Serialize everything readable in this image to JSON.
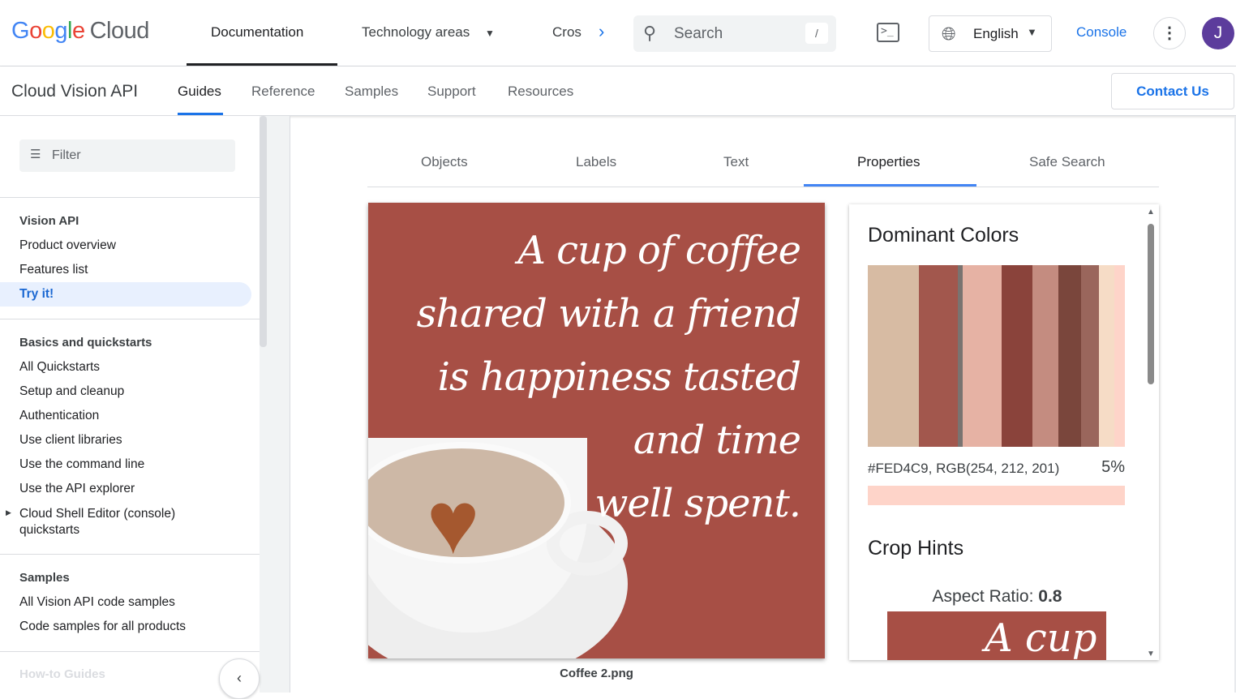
{
  "header": {
    "logo": "Google Cloud",
    "logo_parts": [
      "G",
      "o",
      "o",
      "g",
      "l",
      "e"
    ],
    "logo_cloud": "Cloud",
    "nav": [
      "Documentation",
      "Technology areas",
      "Cros"
    ],
    "search_placeholder": "Search",
    "search_shortcut": "/",
    "language": "English",
    "console": "Console",
    "avatar": "J"
  },
  "subnav": {
    "product": "Cloud Vision API",
    "items": [
      "Guides",
      "Reference",
      "Samples",
      "Support",
      "Resources"
    ],
    "contact": "Contact Us"
  },
  "sidebar": {
    "filter_placeholder": "Filter",
    "sections": [
      {
        "title": "Vision API",
        "items": [
          "Product overview",
          "Features list",
          "Try it!"
        ]
      },
      {
        "title": "Basics and quickstarts",
        "items": [
          "All Quickstarts",
          "Setup and cleanup",
          "Authentication",
          "Use client libraries",
          "Use the command line",
          "Use the API explorer",
          "Cloud Shell Editor (console) quickstarts"
        ]
      },
      {
        "title": "Samples",
        "items": [
          "All Vision API code samples",
          "Code samples for all products"
        ]
      },
      {
        "title": "How-to Guides"
      }
    ]
  },
  "tabs": [
    "Objects",
    "Labels",
    "Text",
    "Properties",
    "Safe Search"
  ],
  "image": {
    "quote_lines": [
      "A cup of coffee",
      "shared with a friend",
      "is happiness tasted",
      "and time",
      "well spent."
    ],
    "caption": "Coffee 2.png"
  },
  "properties": {
    "dominant_title": "Dominant Colors",
    "colors": [
      {
        "hex": "#D7BBA3",
        "pct": 20
      },
      {
        "hex": "#A2574D",
        "pct": 15
      },
      {
        "hex": "#7A7370",
        "pct": 2
      },
      {
        "hex": "#E6B2A4",
        "pct": 15
      },
      {
        "hex": "#8A433B",
        "pct": 12
      },
      {
        "hex": "#C48C80",
        "pct": 10
      },
      {
        "hex": "#7A463C",
        "pct": 9
      },
      {
        "hex": "#9A665C",
        "pct": 7
      },
      {
        "hex": "#F6DCC6",
        "pct": 6
      },
      {
        "hex": "#FED4C9",
        "pct": 4
      }
    ],
    "selected_label": "#FED4C9,  RGB(254, 212, 201)",
    "selected_pct": "5%",
    "selected_hex": "#FED4C9",
    "crop_title": "Crop Hints",
    "aspect_label": "Aspect Ratio: ",
    "aspect_value": "0.8",
    "crop_text": "A cup of"
  }
}
